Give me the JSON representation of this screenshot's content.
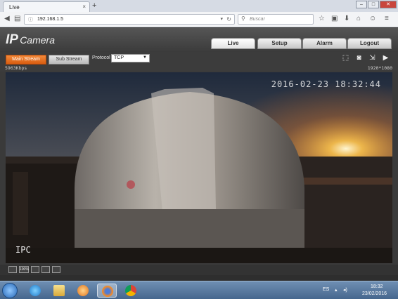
{
  "browser": {
    "tab_title": "Live",
    "tab_close": "×",
    "new_tab": "+",
    "url": "192.168.1.5",
    "search_placeholder": "Buscar",
    "window_buttons": {
      "minimize": "–",
      "maximize": "□",
      "close": "✕"
    }
  },
  "camera": {
    "logo_ip": "IP",
    "logo_camera": "Camera",
    "tabs": [
      {
        "label": "Live"
      },
      {
        "label": "Setup"
      },
      {
        "label": "Alarm"
      },
      {
        "label": "Logout"
      }
    ],
    "main_stream_label": "Main Stream",
    "sub_stream_label": "Sub Stream",
    "protocol_label": "Protocol",
    "protocol_value": "TCP",
    "bitrate": "5963Kbps",
    "resolution": "1920*1080",
    "osd_datetime": "2016-02-23 18:32:44",
    "osd_name": "IPC",
    "bottom_tools": [
      "",
      "100%",
      "",
      "",
      ""
    ]
  },
  "taskbar": {
    "language": "ES",
    "time": "18:32",
    "date": "23/02/2016"
  },
  "colors": {
    "accent_orange": "#e4691c",
    "app_background": "#3a3a3a",
    "taskbar": "#46678e"
  },
  "icons": {
    "toolbar_right": [
      "ptz-icon",
      "snapshot-icon",
      "fullscreen-icon",
      "record-icon"
    ],
    "taskbar_apps": [
      "internet-explorer-icon",
      "file-explorer-icon",
      "media-player-icon",
      "firefox-icon",
      "chrome-icon"
    ]
  }
}
